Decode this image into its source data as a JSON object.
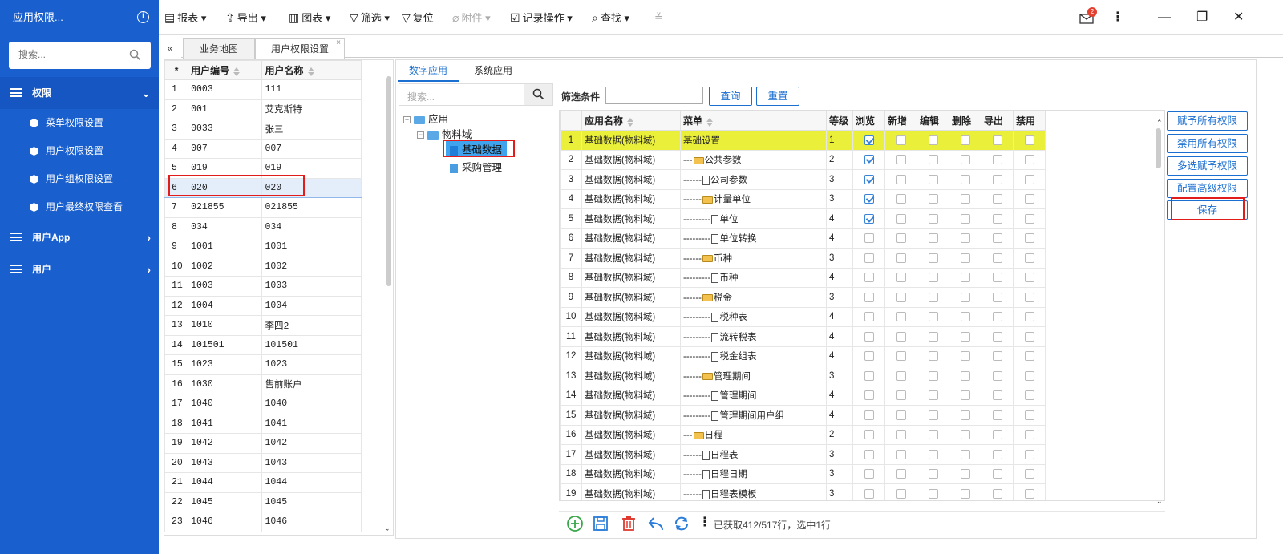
{
  "sidebar": {
    "title": "应用权限...",
    "search_placeholder": "搜索...",
    "groups": [
      {
        "label": "权限",
        "expanded": true,
        "items": [
          "菜单权限设置",
          "用户权限设置",
          "用户组权限设置",
          "用户最终权限查看"
        ]
      },
      {
        "label": "用户App",
        "expanded": false
      },
      {
        "label": "用户",
        "expanded": false
      }
    ]
  },
  "toolbar": {
    "report": "报表",
    "export": "导出",
    "chart": "图表",
    "filter": "筛选",
    "reset": "复位",
    "attachment": "附件",
    "record_ops": "记录操作",
    "find": "查找",
    "notification_count": "2"
  },
  "tabs": [
    "业务地图",
    "用户权限设置"
  ],
  "user_table": {
    "headers": [
      "*",
      "用户编号",
      "用户名称"
    ],
    "rows": [
      [
        "1",
        "0003",
        "111"
      ],
      [
        "2",
        "001",
        "艾克斯特"
      ],
      [
        "3",
        "0033",
        "张三"
      ],
      [
        "4",
        "007",
        "007"
      ],
      [
        "5",
        "019",
        "019"
      ],
      [
        "6",
        "020",
        "020"
      ],
      [
        "7",
        "021855",
        "021855"
      ],
      [
        "8",
        "034",
        "034"
      ],
      [
        "9",
        "1001",
        "1001"
      ],
      [
        "10",
        "1002",
        "1002"
      ],
      [
        "11",
        "1003",
        "1003"
      ],
      [
        "12",
        "1004",
        "1004"
      ],
      [
        "13",
        "1010",
        "李四2"
      ],
      [
        "14",
        "101501",
        "101501"
      ],
      [
        "15",
        "1023",
        "1023"
      ],
      [
        "16",
        "1030",
        "售前账户"
      ],
      [
        "17",
        "1040",
        "1040"
      ],
      [
        "18",
        "1041",
        "1041"
      ],
      [
        "19",
        "1042",
        "1042"
      ],
      [
        "20",
        "1043",
        "1043"
      ],
      [
        "21",
        "1044",
        "1044"
      ],
      [
        "22",
        "1045",
        "1045"
      ],
      [
        "23",
        "1046",
        "1046"
      ]
    ],
    "selected_row": 6
  },
  "subtabs": [
    "数字应用",
    "系统应用"
  ],
  "tree": {
    "search_placeholder": "搜索...",
    "nodes": {
      "root": "应用",
      "domain": "物料域",
      "selected": "基础数据",
      "other": "采购管理"
    }
  },
  "filter": {
    "label": "筛选条件",
    "query": "查询",
    "reset": "重置"
  },
  "perm_grid": {
    "headers": [
      "应用名称",
      "菜单",
      "等级",
      "浏览",
      "新增",
      "编辑",
      "删除",
      "导出",
      "禁用"
    ],
    "rows": [
      {
        "n": "1",
        "app": "基础数据(物料域)",
        "prefix": "",
        "icon": "",
        "menu": "基础设置",
        "level": "1",
        "browse": true
      },
      {
        "n": "2",
        "app": "基础数据(物料域)",
        "prefix": "---",
        "icon": "folder",
        "menu": "公共参数",
        "level": "2",
        "browse": true
      },
      {
        "n": "3",
        "app": "基础数据(物料域)",
        "prefix": "------",
        "icon": "doc",
        "menu": "公司参数",
        "level": "3",
        "browse": true
      },
      {
        "n": "4",
        "app": "基础数据(物料域)",
        "prefix": "------",
        "icon": "folder",
        "menu": "计量单位",
        "level": "3",
        "browse": true
      },
      {
        "n": "5",
        "app": "基础数据(物料域)",
        "prefix": "---------",
        "icon": "doc",
        "menu": "单位",
        "level": "4",
        "browse": true
      },
      {
        "n": "6",
        "app": "基础数据(物料域)",
        "prefix": "---------",
        "icon": "doc",
        "menu": "单位转换",
        "level": "4",
        "browse": false
      },
      {
        "n": "7",
        "app": "基础数据(物料域)",
        "prefix": "------",
        "icon": "folder",
        "menu": "币种",
        "level": "3",
        "browse": false
      },
      {
        "n": "8",
        "app": "基础数据(物料域)",
        "prefix": "---------",
        "icon": "doc",
        "menu": "币种",
        "level": "4",
        "browse": false
      },
      {
        "n": "9",
        "app": "基础数据(物料域)",
        "prefix": "------",
        "icon": "folder",
        "menu": "税金",
        "level": "3",
        "browse": false
      },
      {
        "n": "10",
        "app": "基础数据(物料域)",
        "prefix": "---------",
        "icon": "doc",
        "menu": "税种表",
        "level": "4",
        "browse": false
      },
      {
        "n": "11",
        "app": "基础数据(物料域)",
        "prefix": "---------",
        "icon": "doc",
        "menu": "流转税表",
        "level": "4",
        "browse": false
      },
      {
        "n": "12",
        "app": "基础数据(物料域)",
        "prefix": "---------",
        "icon": "doc",
        "menu": "税金组表",
        "level": "4",
        "browse": false
      },
      {
        "n": "13",
        "app": "基础数据(物料域)",
        "prefix": "------",
        "icon": "folder",
        "menu": "管理期间",
        "level": "3",
        "browse": false
      },
      {
        "n": "14",
        "app": "基础数据(物料域)",
        "prefix": "---------",
        "icon": "doc",
        "menu": "管理期间",
        "level": "4",
        "browse": false
      },
      {
        "n": "15",
        "app": "基础数据(物料域)",
        "prefix": "---------",
        "icon": "doc",
        "menu": "管理期间用户组",
        "level": "4",
        "browse": false
      },
      {
        "n": "16",
        "app": "基础数据(物料域)",
        "prefix": "---",
        "icon": "folder",
        "menu": "日程",
        "level": "2",
        "browse": false
      },
      {
        "n": "17",
        "app": "基础数据(物料域)",
        "prefix": "------",
        "icon": "doc",
        "menu": "日程表",
        "level": "3",
        "browse": false
      },
      {
        "n": "18",
        "app": "基础数据(物料域)",
        "prefix": "------",
        "icon": "doc",
        "menu": "日程日期",
        "level": "3",
        "browse": false
      },
      {
        "n": "19",
        "app": "基础数据(物料域)",
        "prefix": "------",
        "icon": "doc",
        "menu": "日程表模板",
        "level": "3",
        "browse": false
      }
    ]
  },
  "status": "已获取412/517行，选中1行",
  "actions": [
    "赋予所有权限",
    "禁用所有权限",
    "多选赋予权限",
    "配置高级权限",
    "保存"
  ],
  "colors": {
    "sidebar": "#1a5fce",
    "accent": "#1a6fd0",
    "highlight": "#eaf03a",
    "annotation": "#e21b1b"
  }
}
